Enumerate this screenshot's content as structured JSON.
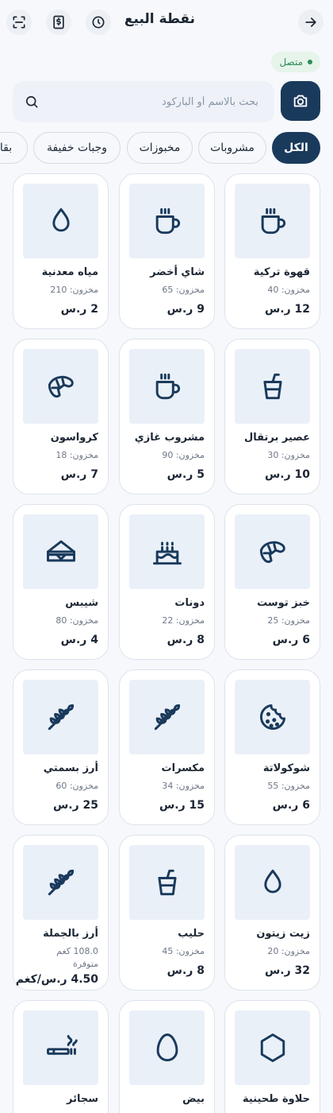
{
  "header": {
    "title": "نقطة البيع",
    "icons": [
      "back-arrow-icon",
      "history-clock-icon",
      "receipt-icon",
      "scan-icon"
    ]
  },
  "status": {
    "label": "متصل",
    "color": "#2e8b57"
  },
  "search": {
    "placeholder": "بحث بالاسم أو الباركود"
  },
  "categories": [
    {
      "label": "الكل",
      "active": true
    },
    {
      "label": "مشروبات",
      "active": false
    },
    {
      "label": "مخبوزات",
      "active": false
    },
    {
      "label": "وجبات خفيفة",
      "active": false
    },
    {
      "label": "بقا",
      "active": false
    }
  ],
  "colors": {
    "accent": "#1a3a5c",
    "thumb_bg": "#eaf0f8",
    "online": "#2e8b57"
  },
  "products": [
    {
      "name": "قهوة تركية",
      "stock": "مخزون: 40",
      "price": "12 ر.س",
      "icon": "coffee-cup-icon"
    },
    {
      "name": "شاي أخضر",
      "stock": "مخزون: 65",
      "price": "9 ر.س",
      "icon": "coffee-cup-icon"
    },
    {
      "name": "مياه معدنية",
      "stock": "مخزون: 210",
      "price": "2 ر.س",
      "icon": "water-drop-icon"
    },
    {
      "name": "عصير برتقال",
      "stock": "مخزون: 30",
      "price": "10 ر.س",
      "icon": "juice-cup-icon"
    },
    {
      "name": "مشروب غازي",
      "stock": "مخزون: 90",
      "price": "5 ر.س",
      "icon": "coffee-cup-icon"
    },
    {
      "name": "كرواسون",
      "stock": "مخزون: 18",
      "price": "7 ر.س",
      "icon": "croissant-icon"
    },
    {
      "name": "خبز توست",
      "stock": "مخزون: 25",
      "price": "6 ر.س",
      "icon": "croissant-icon"
    },
    {
      "name": "دونات",
      "stock": "مخزون: 22",
      "price": "8 ر.س",
      "icon": "cake-icon"
    },
    {
      "name": "شيبس",
      "stock": "مخزون: 80",
      "price": "4 ر.س",
      "icon": "sandwich-icon"
    },
    {
      "name": "شوكولاتة",
      "stock": "مخزون: 55",
      "price": "6 ر.س",
      "icon": "cookie-icon"
    },
    {
      "name": "مكسرات",
      "stock": "مخزون: 34",
      "price": "15 ر.س",
      "icon": "wheat-icon"
    },
    {
      "name": "أرز بسمتي",
      "stock": "مخزون: 60",
      "price": "25 ر.س",
      "icon": "wheat-icon"
    },
    {
      "name": "زيت زيتون",
      "stock": "مخزون: 20",
      "price": "32 ر.س",
      "icon": "water-drop-icon"
    },
    {
      "name": "حليب",
      "stock": "مخزون: 45",
      "price": "8 ر.س",
      "icon": "juice-cup-icon"
    },
    {
      "name": "أرز بالجملة",
      "stock": "108.0 كغم",
      "stock2": "متوفرة",
      "price": "4.50 ر.س/كغم",
      "icon": "wheat-icon"
    },
    {
      "name": "حلاوة طحينية",
      "stock": "",
      "price": "",
      "icon": "hexagon-icon"
    },
    {
      "name": "بيض",
      "stock": "",
      "price": "",
      "icon": "egg-icon"
    },
    {
      "name": "سجائر",
      "stock": "",
      "price": "",
      "icon": "cigarette-icon"
    }
  ]
}
